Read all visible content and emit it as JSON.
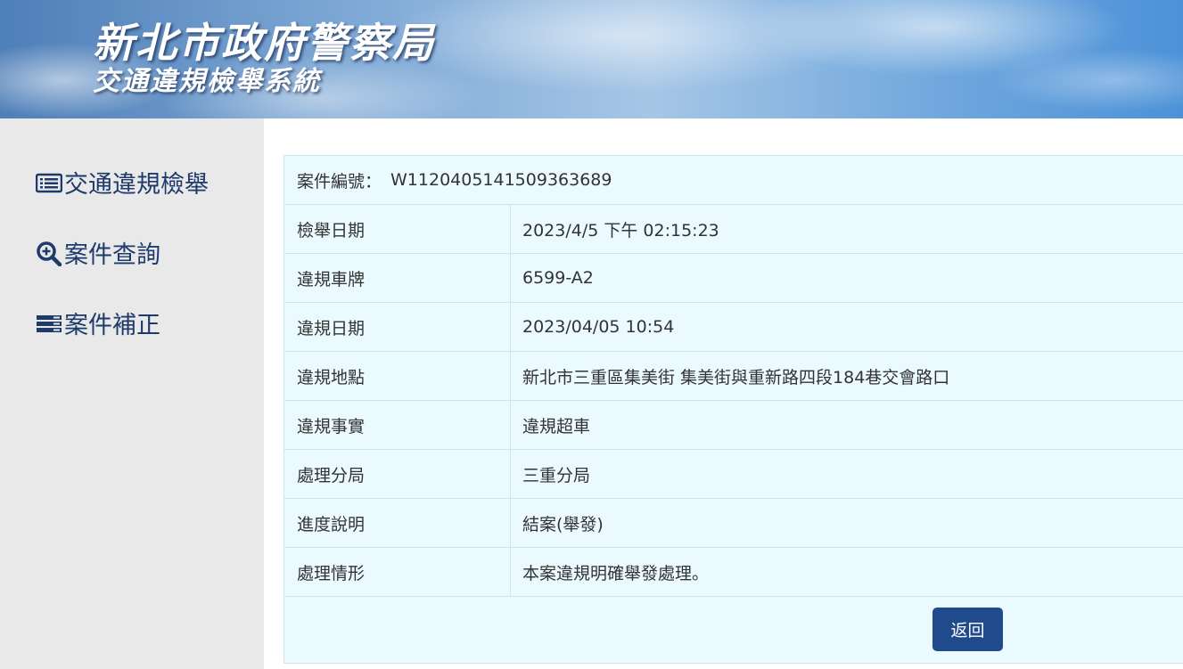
{
  "banner": {
    "title": "新北市政府警察局",
    "subtitle": "交通違規檢舉系統"
  },
  "sidebar": {
    "items": [
      {
        "label": "交通違規檢舉",
        "icon": "list-icon"
      },
      {
        "label": "案件查詢",
        "icon": "search-plus-icon"
      },
      {
        "label": "案件補正",
        "icon": "server-icon"
      }
    ]
  },
  "case": {
    "number_label": "案件編號：",
    "number_value": "W1120405141509363689",
    "rows": [
      {
        "label": "檢舉日期",
        "value": "2023/4/5 下午 02:15:23"
      },
      {
        "label": "違規車牌",
        "value": "6599-A2"
      },
      {
        "label": "違規日期",
        "value": "2023/04/05 10:54"
      },
      {
        "label": "違規地點",
        "value": "新北市三重區集美街 集美街與重新路四段184巷交會路口"
      },
      {
        "label": "違規事實",
        "value": "違規超車"
      },
      {
        "label": "處理分局",
        "value": "三重分局"
      },
      {
        "label": "進度說明",
        "value": "結案(舉發)"
      },
      {
        "label": "處理情形",
        "value": "本案違規明確舉發處理。"
      }
    ]
  },
  "actions": {
    "back_label": "返回"
  },
  "colors": {
    "nav_text": "#1d3a6b",
    "card_bg": "#eafaff",
    "button_bg": "#1f4a8c"
  }
}
